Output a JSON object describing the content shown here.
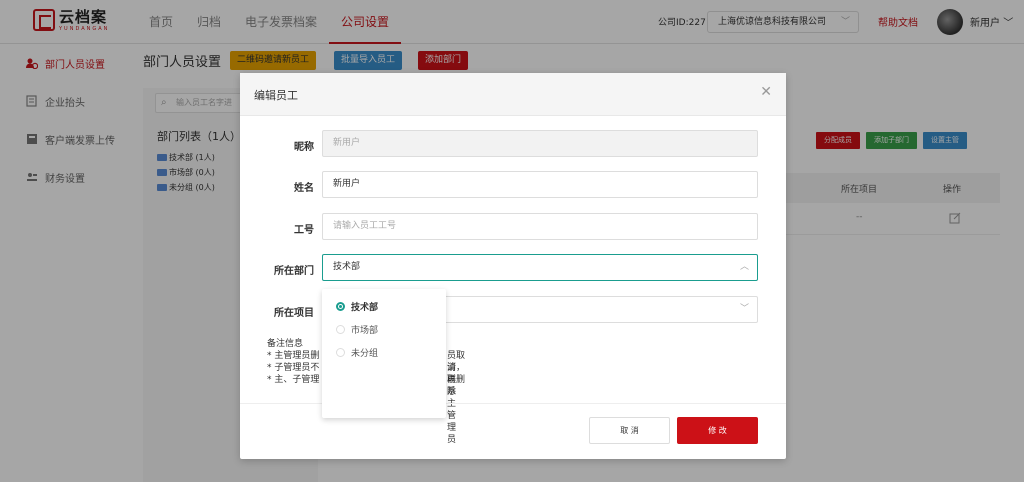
{
  "app": {
    "logo_cn": "云档案",
    "logo_en": "YUNDANGAN"
  },
  "nav": [
    {
      "label": "首页"
    },
    {
      "label": "归档"
    },
    {
      "label": "电子发票档案"
    },
    {
      "label": "公司设置"
    }
  ],
  "header": {
    "company_id": "公司ID:227",
    "company_select": "上海优谅信息科技有限公司",
    "help": "帮助文档",
    "user": "新用户"
  },
  "sidebar": {
    "items": [
      {
        "label": "部门人员设置",
        "icon": "user-group-icon"
      },
      {
        "label": "企业抬头",
        "icon": "document-icon"
      },
      {
        "label": "客户端发票上传",
        "icon": "upload-icon"
      },
      {
        "label": "财务设置",
        "icon": "settings-icon"
      }
    ]
  },
  "page": {
    "title": "部门人员设置",
    "buttons": {
      "qr_invite": "二维码邀请新员工",
      "bulk_import": "批量导入员工",
      "add_dept": "添加部门"
    },
    "search_placeholder": "输入员工名字进",
    "dept_list_title": "部门列表（1人）",
    "depts": [
      {
        "label": "技术部 (1人)"
      },
      {
        "label": "市场部 (0人)"
      },
      {
        "label": "未分组 (0人)"
      }
    ],
    "toolbar": {
      "assign": "分配成员",
      "add_sub": "添加子部门",
      "set_manager": "设置主管"
    },
    "table": {
      "col_project": "所在项目",
      "col_action": "操作",
      "row_project": "--"
    }
  },
  "modal": {
    "title": "编辑员工",
    "fields": {
      "nickname_label": "昵称",
      "nickname_value": "新用户",
      "name_label": "姓名",
      "name_value": "新用户",
      "empno_label": "工号",
      "empno_placeholder": "请输入员工工号",
      "dept_label": "所在部门",
      "dept_value": "技术部",
      "project_label": "所在项目"
    },
    "remarks": {
      "title": "备注信息",
      "line1": "* 主管理员删",
      "line1_tail": "员取消，再删除",
      "line2": "* 子管理员不",
      "line2_tail": "请联系主管理员",
      "line3": "* 主、子管理"
    },
    "dropdown_options": [
      {
        "label": "技术部",
        "selected": true
      },
      {
        "label": "市场部",
        "selected": false
      },
      {
        "label": "未分组",
        "selected": false
      }
    ],
    "cancel": "取 消",
    "submit": "修 改"
  },
  "colors": {
    "brand_red": "#c8161d",
    "accent_teal": "#1a9d8f",
    "orange": "#e8a400",
    "blue": "#3a8ecb",
    "green": "#3aa04a"
  }
}
